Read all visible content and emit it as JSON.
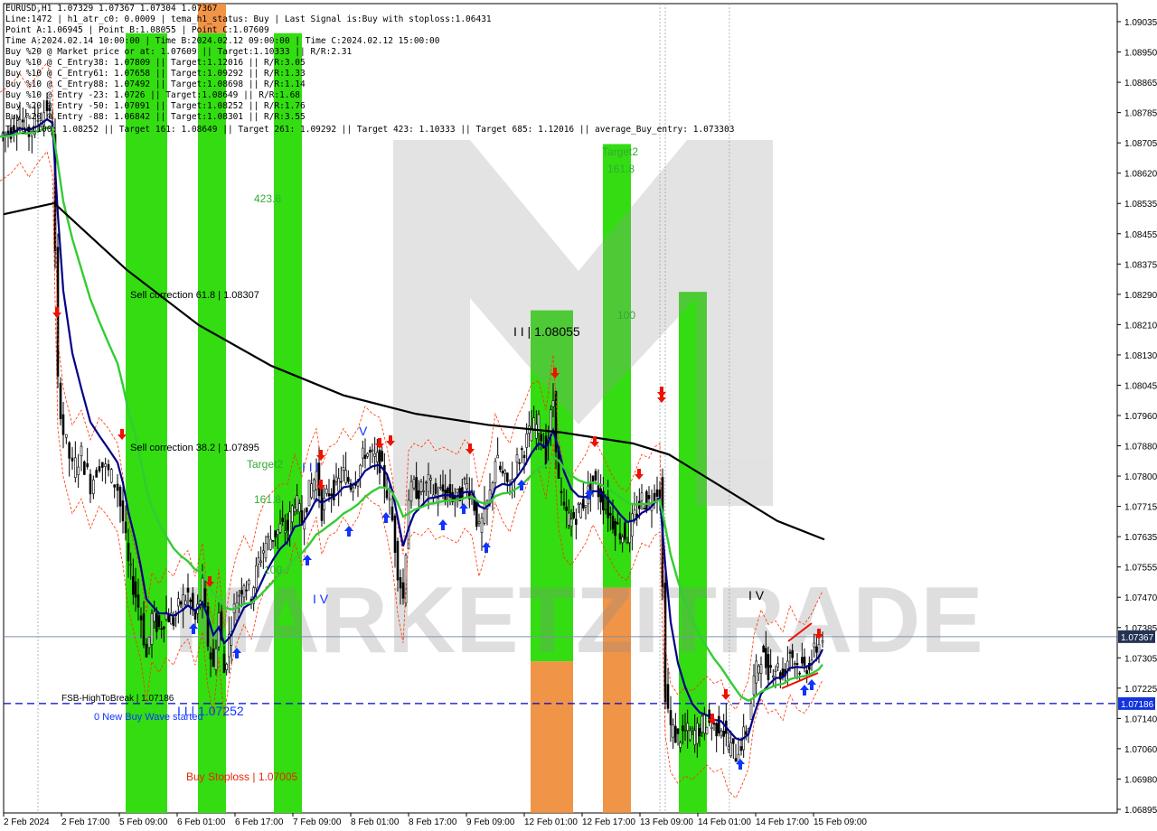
{
  "header": {
    "symbol_line": "EURUSD,H1  1.07329 1.07367 1.07304 1.07367",
    "info_lines": [
      "Line:1472 | h1_atr_c0: 0.0009 | tema_h1_status: Buy | Last Signal is:Buy with stoploss:1.06431",
      "Point A:1.06945 | Point B:1.08055 | Point C:1.07609",
      "Time A:2024.02.14 10:00:00 | Time B:2024.02.12 09:00:00 | Time C:2024.02.12 15:00:00",
      "Buy %20 @ Market price or at: 1.07609 || Target:1.10333 || R/R:2.31",
      "Buy %10 @ C_Entry38: 1.07809 || Target:1.12016 || R/R:3.05",
      "Buy %10 @ C_Entry61: 1.07658 || Target:1.09292 || R/R:1.33",
      "Buy %10 @ C_Entry88: 1.07492 || Target:1.08698 || R/R:1.14",
      "Buy %10 @ Entry -23: 1.0726 || Target:1.08649 || R/R:1.68",
      "Buy %20 @ Entry -50: 1.07091 || Target:1.08252 || R/R:1.76",
      "Buy %20 @ Entry -88: 1.06842 || Target:1.08301 || R/R:3.55"
    ],
    "targets_line": "Target100: 1.08252 || Target 161: 1.08649 || Target 261: 1.09292 || Target 423: 1.10333 || Target 685: 1.12016 || average_Buy_entry: 1.073303"
  },
  "price_axis": {
    "labels": [
      "1.09035",
      "1.08950",
      "1.08865",
      "1.08785",
      "1.08705",
      "1.08620",
      "1.08535",
      "1.08455",
      "1.08375",
      "1.08290",
      "1.08210",
      "1.08130",
      "1.08045",
      "1.07960",
      "1.07880",
      "1.07800",
      "1.07715",
      "1.07635",
      "1.07555",
      "1.07470",
      "1.07385",
      "1.07305",
      "1.07225",
      "1.07140",
      "1.07060",
      "1.06980",
      "1.06895"
    ],
    "current_price": "1.07367",
    "fsb_price": "1.07186",
    "min": 1.0689,
    "max": 1.0908
  },
  "time_axis": {
    "labels": [
      "2 Feb 2024",
      "2 Feb 17:00",
      "5 Feb 09:00",
      "6 Feb 01:00",
      "6 Feb 17:00",
      "7 Feb 09:00",
      "8 Feb 01:00",
      "8 Feb 17:00",
      "9 Feb 09:00",
      "12 Feb 01:00",
      "12 Feb 17:00",
      "13 Feb 09:00",
      "14 Feb 01:00",
      "14 Feb 17:00",
      "15 Feb 09:00"
    ]
  },
  "annotations": {
    "sell_corr_618": "Sell correction 61.8 | 1.08307",
    "sell_corr_382": "Sell correction 38.2 | 1.07895",
    "point_b": "I I | 1.08055",
    "point_a": "I I | 1.07252",
    "point_c": "I V",
    "wave_iv_left": "I V",
    "wave_iii": "I I I",
    "wave_v": "V",
    "fsb_label": "FSB-HighToBreak | 1.07186",
    "new_wave": "0 New Buy Wave started",
    "buy_stoploss": "Buy Stoploss | 1.07005",
    "target2_left": "Target2",
    "target2_right": "Target2",
    "level_423": "423.6",
    "level_1618": "161.8",
    "level_100": "100",
    "level_100_small": "100",
    "level_1618_right": "161.8"
  },
  "watermark": {
    "text": "MARKETZITRADE"
  },
  "colors": {
    "green_zone": "#33dd11",
    "orange_zone": "#ee8833",
    "ema_fast": "#000088",
    "ema_mid": "#33cc33",
    "ema_slow": "#000000",
    "envelope": "#ff3300",
    "fsb_line": "#0000cc",
    "buy_arrow": "#1133ff",
    "sell_arrow": "#ee1100"
  },
  "chart_data": {
    "type": "candlestick",
    "symbol": "EURUSD",
    "timeframe": "H1",
    "ohlc_last": {
      "open": 1.07329,
      "high": 1.07367,
      "low": 1.07304,
      "close": 1.07367
    },
    "ylim": [
      1.0689,
      1.0908
    ],
    "series": [
      {
        "name": "close_path",
        "points": [
          [
            0,
            1.0872
          ],
          [
            12,
            1.0874
          ],
          [
            22,
            1.0877
          ],
          [
            32,
            1.0873
          ],
          [
            42,
            1.0877
          ],
          [
            52,
            1.088
          ],
          [
            58,
            1.0874
          ],
          [
            64,
            1.0805
          ],
          [
            70,
            1.0792
          ],
          [
            80,
            1.0782
          ],
          [
            90,
            1.0786
          ],
          [
            100,
            1.0778
          ],
          [
            110,
            1.0784
          ],
          [
            120,
            1.0781
          ],
          [
            130,
            1.0777
          ],
          [
            136,
            1.0768
          ],
          [
            142,
            1.0756
          ],
          [
            150,
            1.0748
          ],
          [
            156,
            1.0742
          ],
          [
            162,
            1.0731
          ],
          [
            168,
            1.0742
          ],
          [
            176,
            1.0739
          ],
          [
            184,
            1.0743
          ],
          [
            192,
            1.0741
          ],
          [
            200,
            1.0746
          ],
          [
            208,
            1.0748
          ],
          [
            216,
            1.0741
          ],
          [
            224,
            1.075
          ],
          [
            230,
            1.0735
          ],
          [
            236,
            1.0728
          ],
          [
            242,
            1.0743
          ],
          [
            248,
            1.0727
          ],
          [
            256,
            1.0741
          ],
          [
            262,
            1.0747
          ],
          [
            270,
            1.0752
          ],
          [
            278,
            1.0748
          ],
          [
            286,
            1.0757
          ],
          [
            294,
            1.0762
          ],
          [
            302,
            1.0764
          ],
          [
            310,
            1.0766
          ],
          [
            318,
            1.0766
          ],
          [
            326,
            1.0774
          ],
          [
            334,
            1.0768
          ],
          [
            342,
            1.0776
          ],
          [
            350,
            1.0781
          ],
          [
            356,
            1.0771
          ],
          [
            364,
            1.0776
          ],
          [
            372,
            1.0777
          ],
          [
            380,
            1.0781
          ],
          [
            388,
            1.0778
          ],
          [
            396,
            1.0781
          ],
          [
            404,
            1.0787
          ],
          [
            412,
            1.0785
          ],
          [
            420,
            1.0784
          ],
          [
            428,
            1.0776
          ],
          [
            434,
            1.0768
          ],
          [
            440,
            1.0755
          ],
          [
            446,
            1.0747
          ],
          [
            452,
            1.0775
          ],
          [
            458,
            1.0777
          ],
          [
            466,
            1.0776
          ],
          [
            474,
            1.0778
          ],
          [
            482,
            1.0775
          ],
          [
            490,
            1.0776
          ],
          [
            498,
            1.0775
          ],
          [
            506,
            1.0774
          ],
          [
            514,
            1.0778
          ],
          [
            522,
            1.0776
          ],
          [
            530,
            1.0765
          ],
          [
            536,
            1.077
          ],
          [
            542,
            1.0775
          ],
          [
            548,
            1.0785
          ],
          [
            556,
            1.078
          ],
          [
            564,
            1.0777
          ],
          [
            572,
            1.0784
          ],
          [
            580,
            1.0788
          ],
          [
            588,
            1.0793
          ],
          [
            596,
            1.0794
          ],
          [
            604,
            1.0786
          ],
          [
            612,
            1.0801
          ],
          [
            618,
            1.0778
          ],
          [
            624,
            1.077
          ],
          [
            632,
            1.0768
          ],
          [
            640,
            1.0771
          ],
          [
            648,
            1.0774
          ],
          [
            656,
            1.0779
          ],
          [
            662,
            1.0776
          ],
          [
            670,
            1.0772
          ],
          [
            678,
            1.0768
          ],
          [
            686,
            1.0765
          ],
          [
            694,
            1.0764
          ],
          [
            702,
            1.0769
          ],
          [
            710,
            1.0774
          ],
          [
            718,
            1.0773
          ],
          [
            724,
            1.0776
          ],
          [
            730,
            1.0777
          ],
          [
            736,
            1.0722
          ],
          [
            742,
            1.0712
          ],
          [
            750,
            1.0709
          ],
          [
            758,
            1.0711
          ],
          [
            766,
            1.071
          ],
          [
            774,
            1.0712
          ],
          [
            782,
            1.0714
          ],
          [
            790,
            1.0712
          ],
          [
            798,
            1.0713
          ],
          [
            806,
            1.0707
          ],
          [
            814,
            1.0705
          ],
          [
            820,
            1.0708
          ],
          [
            828,
            1.0713
          ],
          [
            834,
            1.0725
          ],
          [
            842,
            1.0732
          ],
          [
            850,
            1.0728
          ],
          [
            858,
            1.0729
          ],
          [
            866,
            1.0726
          ],
          [
            874,
            1.0733
          ],
          [
            882,
            1.0729
          ],
          [
            890,
            1.0728
          ],
          [
            898,
            1.0731
          ],
          [
            906,
            1.0735
          ],
          [
            910,
            1.0737
          ]
        ]
      },
      {
        "name": "ema_fast"
      },
      {
        "name": "ema_mid"
      },
      {
        "name": "ema_slow"
      }
    ],
    "green_zones": [
      {
        "x0": 139,
        "x1": 185,
        "y_top": 1.09,
        "y_bot": 1.0689
      },
      {
        "x0": 219,
        "x1": 250,
        "y_top": 1.09,
        "y_bot": 1.0689
      },
      {
        "x0": 303,
        "x1": 334,
        "y_top": 1.09,
        "y_bot": 1.0689
      },
      {
        "x0": 587,
        "x1": 634,
        "y_top": 1.0825,
        "y_bot": 1.073
      },
      {
        "x0": 667,
        "x1": 698,
        "y_top": 1.087,
        "y_bot": 1.075
      },
      {
        "x0": 751,
        "x1": 782,
        "y_top": 1.083,
        "y_bot": 1.0689
      }
    ],
    "orange_zones": [
      {
        "x0": 219,
        "x1": 250,
        "y_top": 1.0908,
        "y_bot": 1.09
      },
      {
        "x0": 587,
        "x1": 634,
        "y_top": 1.073,
        "y_bot": 1.0689
      },
      {
        "x0": 667,
        "x1": 698,
        "y_top": 1.075,
        "y_bot": 1.0689
      }
    ]
  }
}
